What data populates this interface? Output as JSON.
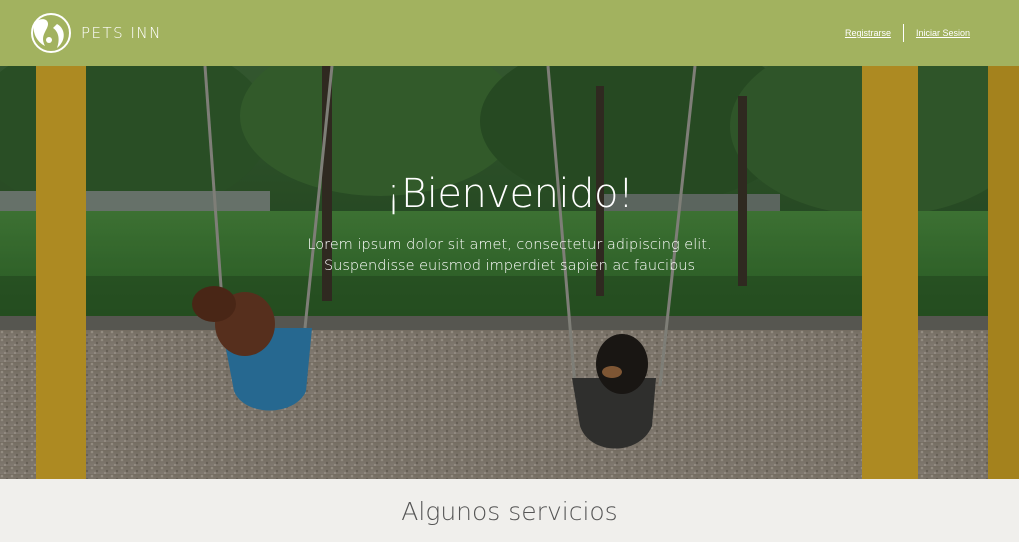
{
  "header": {
    "logo_text": "PETS INN",
    "register_label": "Registrarse",
    "login_label": "Iniciar Sesion"
  },
  "hero": {
    "title": "¡Bienvenido!",
    "subtitle_line1": "Lorem ipsum dolor sit amet, consectetur adipiscing elit.",
    "subtitle_line2": "Suspendisse euismod imperdiet sapien ac faucibus"
  },
  "services": {
    "title": "Algunos servicios"
  },
  "colors": {
    "header_bg": "#a2b25f",
    "section_bg": "#f0efec",
    "text_light": "#ffffff",
    "heading_dark": "#555555"
  },
  "icons": [
    "pets-inn-logo-icon"
  ]
}
